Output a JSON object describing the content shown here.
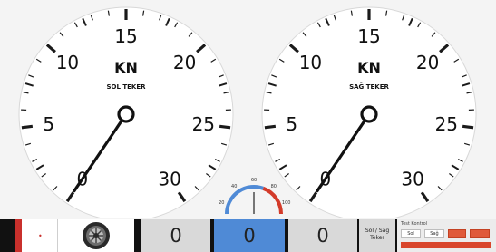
{
  "brand": {
    "text": "",
    "color": "#d33b2a"
  },
  "gauges": [
    {
      "id": "left",
      "unit": "KN",
      "label": "SOL TEKER",
      "scale": {
        "min": 0,
        "max": 30,
        "major_labels": [
          0,
          5,
          10,
          15,
          20,
          25,
          30
        ]
      },
      "value": 0
    },
    {
      "id": "right",
      "unit": "KN",
      "label": "SAĞ TEKER",
      "scale": {
        "min": 0,
        "max": 30,
        "major_labels": [
          0,
          5,
          10,
          15,
          20,
          25,
          30
        ]
      },
      "value": 0
    }
  ],
  "speedometer": {
    "tick_labels": [
      "20",
      "40",
      "60",
      "80",
      "100"
    ],
    "value_fraction": 0.5
  },
  "bottom_bar": {
    "indicator_dot": "•",
    "wheel_icon": "wheel-icon",
    "readouts": [
      "0",
      "0",
      "0"
    ],
    "side_button": {
      "line1": "Sol / Sağ",
      "line2": "Teker"
    },
    "control_panel": {
      "title": "Test Kontrol",
      "buttons": [
        "Sol",
        "Sağ",
        "",
        ""
      ],
      "status": ""
    }
  },
  "colors": {
    "accent_red": "#c9302c",
    "highlight_blue": "#4f8ad6"
  }
}
